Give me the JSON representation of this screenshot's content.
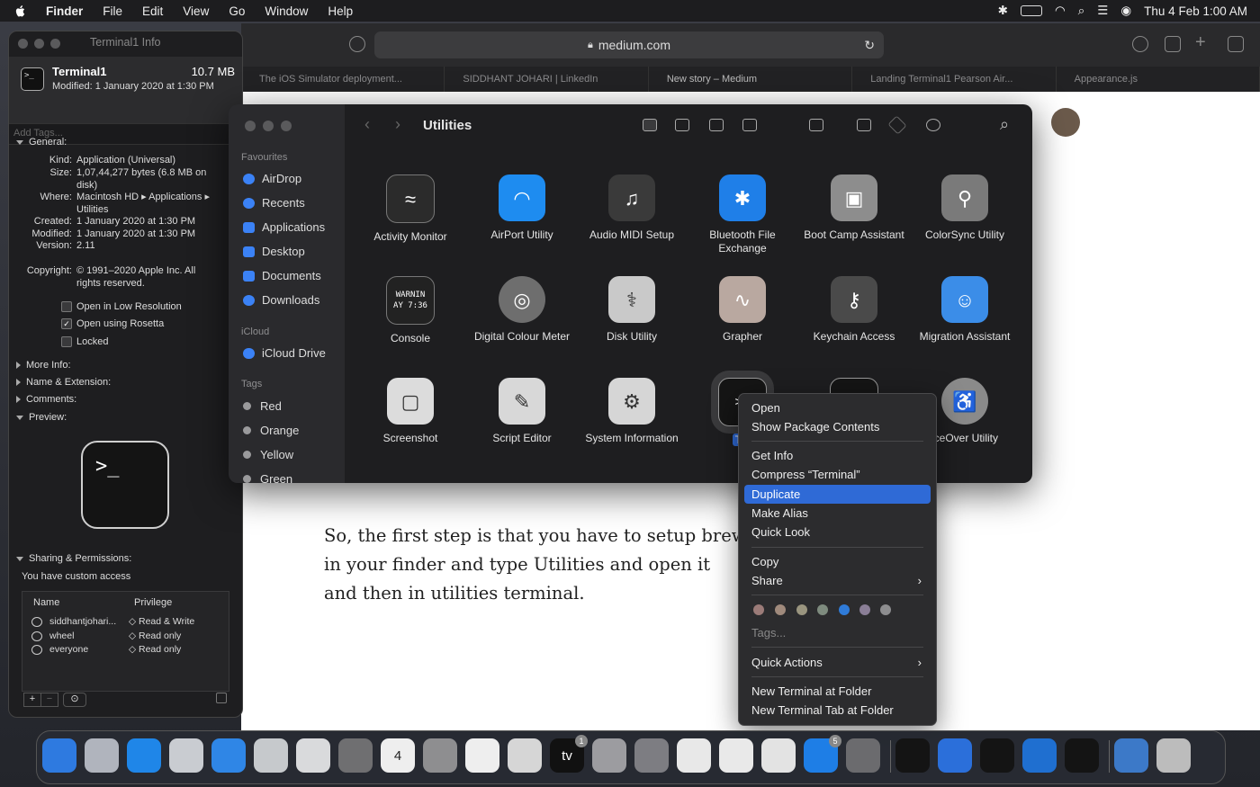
{
  "menubar": {
    "app": "Finder",
    "items": [
      "File",
      "Edit",
      "View",
      "Go",
      "Window",
      "Help"
    ],
    "clock": "Thu 4 Feb  1:00 AM"
  },
  "safari": {
    "url": "medium.com",
    "tabs": [
      "The iOS Simulator deployment...",
      "SIDDHANT JOHARI | LinkedIn",
      "New story – Medium",
      "Landing Terminal1 Pearson Air...",
      "Appearance.js"
    ],
    "article": "So, the first step is that you have to setup brew in your finder and type Utilities and open it and then in utilities terminal."
  },
  "info": {
    "window_title": "Terminal1 Info",
    "name": "Terminal1",
    "size": "10.7 MB",
    "modified_line": "Modified: 1 January 2020 at 1:30 PM",
    "tags_placeholder": "Add Tags...",
    "general_label": "General:",
    "general": [
      {
        "k": "Kind:",
        "v": "Application (Universal)"
      },
      {
        "k": "Size:",
        "v": "1,07,44,277 bytes (6.8 MB on disk)"
      },
      {
        "k": "Where:",
        "v": "Macintosh HD ▸ Applications ▸ Utilities"
      },
      {
        "k": "Created:",
        "v": "1 January 2020 at 1:30 PM"
      },
      {
        "k": "Modified:",
        "v": "1 January 2020 at 1:30 PM"
      },
      {
        "k": "Version:",
        "v": "2.11"
      },
      {
        "k": "Copyright:",
        "v": "© 1991–2020 Apple Inc. All rights reserved."
      }
    ],
    "options": [
      {
        "label": "Open in Low Resolution",
        "checked": false
      },
      {
        "label": "Open using Rosetta",
        "checked": true
      },
      {
        "label": "Locked",
        "checked": false
      }
    ],
    "sections": [
      "More Info:",
      "Name & Extension:",
      "Comments:",
      "Preview:"
    ],
    "preview_glyph": ">_",
    "sharing_label": "Sharing & Permissions:",
    "access_text": "You have custom access",
    "perm_headers": [
      "Name",
      "Privilege"
    ],
    "perms": [
      {
        "name": "siddhantjohari...",
        "priv": "◇ Read & Write"
      },
      {
        "name": "wheel",
        "priv": "◇ Read only"
      },
      {
        "name": "everyone",
        "priv": "◇ Read only"
      }
    ]
  },
  "finder": {
    "title": "Utilities",
    "favourites_label": "Favourites",
    "favourites": [
      "AirDrop",
      "Recents",
      "Applications",
      "Desktop",
      "Documents",
      "Downloads"
    ],
    "icloud_label": "iCloud",
    "icloud": [
      "iCloud Drive"
    ],
    "tags_label": "Tags",
    "tags": [
      {
        "name": "Red",
        "color": "#9a9a9c"
      },
      {
        "name": "Orange",
        "color": "#9a9a9c"
      },
      {
        "name": "Yellow",
        "color": "#9a9a9c"
      },
      {
        "name": "Green",
        "color": "#9a9a9c"
      }
    ],
    "apps": [
      {
        "name": "Activity Monitor",
        "icon": "activity-monitor-icon",
        "color": "#2b2b2b"
      },
      {
        "name": "AirPort Utility",
        "icon": "airport-utility-icon",
        "color": "#1e8cf0"
      },
      {
        "name": "Audio MIDI Setup",
        "icon": "audio-midi-icon",
        "color": "#3a3a3a"
      },
      {
        "name": "Bluetooth File Exchange",
        "icon": "bluetooth-icon",
        "color": "#1f7fe8"
      },
      {
        "name": "Boot Camp Assistant",
        "icon": "bootcamp-icon",
        "color": "#8d8d8d"
      },
      {
        "name": "ColorSync Utility",
        "icon": "colorsync-icon",
        "color": "#7a7a7a"
      },
      {
        "name": "Console",
        "icon": "console-icon",
        "color": "#222222"
      },
      {
        "name": "Digital Colour Meter",
        "icon": "colour-meter-icon",
        "color": "#6e6e6e"
      },
      {
        "name": "Disk Utility",
        "icon": "disk-utility-icon",
        "color": "#c9c9c9"
      },
      {
        "name": "Grapher",
        "icon": "grapher-icon",
        "color": "#b9a8a0"
      },
      {
        "name": "Keychain Access",
        "icon": "keychain-icon",
        "color": "#4a4a4a"
      },
      {
        "name": "Migration Assistant",
        "icon": "migration-icon",
        "color": "#3b8de8"
      },
      {
        "name": "Screenshot",
        "icon": "screenshot-icon",
        "color": "#dcdcdc"
      },
      {
        "name": "Script Editor",
        "icon": "script-editor-icon",
        "color": "#d8d8d8"
      },
      {
        "name": "System Information",
        "icon": "system-info-icon",
        "color": "#d6d6d6"
      },
      {
        "name": "Ter",
        "icon": "terminal-icon",
        "color": "#151515"
      },
      {
        "name": "",
        "icon": "terminal-icon",
        "color": "#151515"
      },
      {
        "name": "iceOver Utility",
        "icon": "voiceover-icon",
        "color": "#8a8a8a"
      }
    ],
    "glyphs": {
      "terminal": ">_",
      "console": "WARNIN AY 7:36"
    }
  },
  "context_menu": {
    "items": [
      {
        "label": "Open"
      },
      {
        "label": "Show Package Contents"
      },
      {
        "label": "Get Info"
      },
      {
        "label": "Compress “Terminal”"
      },
      {
        "label": "Duplicate"
      },
      {
        "label": "Make Alias"
      },
      {
        "label": "Quick Look"
      },
      {
        "label": "Copy"
      },
      {
        "label": "Share"
      },
      {
        "label": "Tags..."
      },
      {
        "label": "Quick Actions"
      },
      {
        "label": "New Terminal at Folder"
      },
      {
        "label": "New Terminal Tab at Folder"
      }
    ],
    "highlighted": "Duplicate",
    "tag_colors": [
      "#9b7b78",
      "#a08a7c",
      "#9a957f",
      "#7e8b7e",
      "#2f7bd8",
      "#8a7e96",
      "#8d8d8f"
    ]
  },
  "dock": {
    "apps": [
      {
        "name": "Finder",
        "icon": "finder-icon",
        "color": "#2e7ae0"
      },
      {
        "name": "Launchpad",
        "icon": "launchpad-icon",
        "color": "#b0b4bd"
      },
      {
        "name": "Safari",
        "icon": "safari-icon",
        "color": "#1f86e8"
      },
      {
        "name": "Messages",
        "icon": "messages-icon",
        "color": "#c9ccd1"
      },
      {
        "name": "Mail",
        "icon": "mail-icon",
        "color": "#2f86e6"
      },
      {
        "name": "Maps",
        "icon": "maps-icon",
        "color": "#c6c9cc"
      },
      {
        "name": "Photos",
        "icon": "photos-icon",
        "color": "#d9dadc"
      },
      {
        "name": "FaceTime",
        "icon": "facetime-icon",
        "color": "#6f6f71"
      },
      {
        "name": "Calendar",
        "icon": "calendar-icon",
        "color": "#eeeeee",
        "label": "4"
      },
      {
        "name": "Contacts",
        "icon": "contacts-icon",
        "color": "#8e8e90"
      },
      {
        "name": "Reminders",
        "icon": "reminders-icon",
        "color": "#eeeeee"
      },
      {
        "name": "Notes",
        "icon": "notes-icon",
        "color": "#d6d6d6"
      },
      {
        "name": "TV",
        "icon": "tv-icon",
        "color": "#111111",
        "label": "tv",
        "badge": "1"
      },
      {
        "name": "Music",
        "icon": "music-icon",
        "color": "#9c9ca0"
      },
      {
        "name": "Podcasts",
        "icon": "podcasts-icon",
        "color": "#7d7d82"
      },
      {
        "name": "Keynote",
        "icon": "keynote-icon",
        "color": "#e8e8e8"
      },
      {
        "name": "Numbers",
        "icon": "numbers-icon",
        "color": "#e9e9e9"
      },
      {
        "name": "Pages",
        "icon": "pages-icon",
        "color": "#e3e3e3"
      },
      {
        "name": "App Store",
        "icon": "app-store-icon",
        "color": "#1e7ee6",
        "badge": "5"
      },
      {
        "name": "System Preferences",
        "icon": "system-preferences-icon",
        "color": "#6b6b6e"
      },
      {
        "name": "Terminal",
        "icon": "terminal-icon",
        "color": "#141414"
      },
      {
        "name": "Xcode",
        "icon": "xcode-icon",
        "color": "#2b6fda"
      },
      {
        "name": "Terminal",
        "icon": "terminal-icon",
        "color": "#141414"
      },
      {
        "name": "VS Code",
        "icon": "vscode-icon",
        "color": "#1f6fd0"
      },
      {
        "name": "Terminal",
        "icon": "terminal-icon",
        "color": "#141414"
      },
      {
        "name": "Downloads",
        "icon": "downloads-folder-icon",
        "color": "#3c79c8"
      },
      {
        "name": "Trash",
        "icon": "trash-icon",
        "color": "#bcbcbc"
      }
    ]
  }
}
